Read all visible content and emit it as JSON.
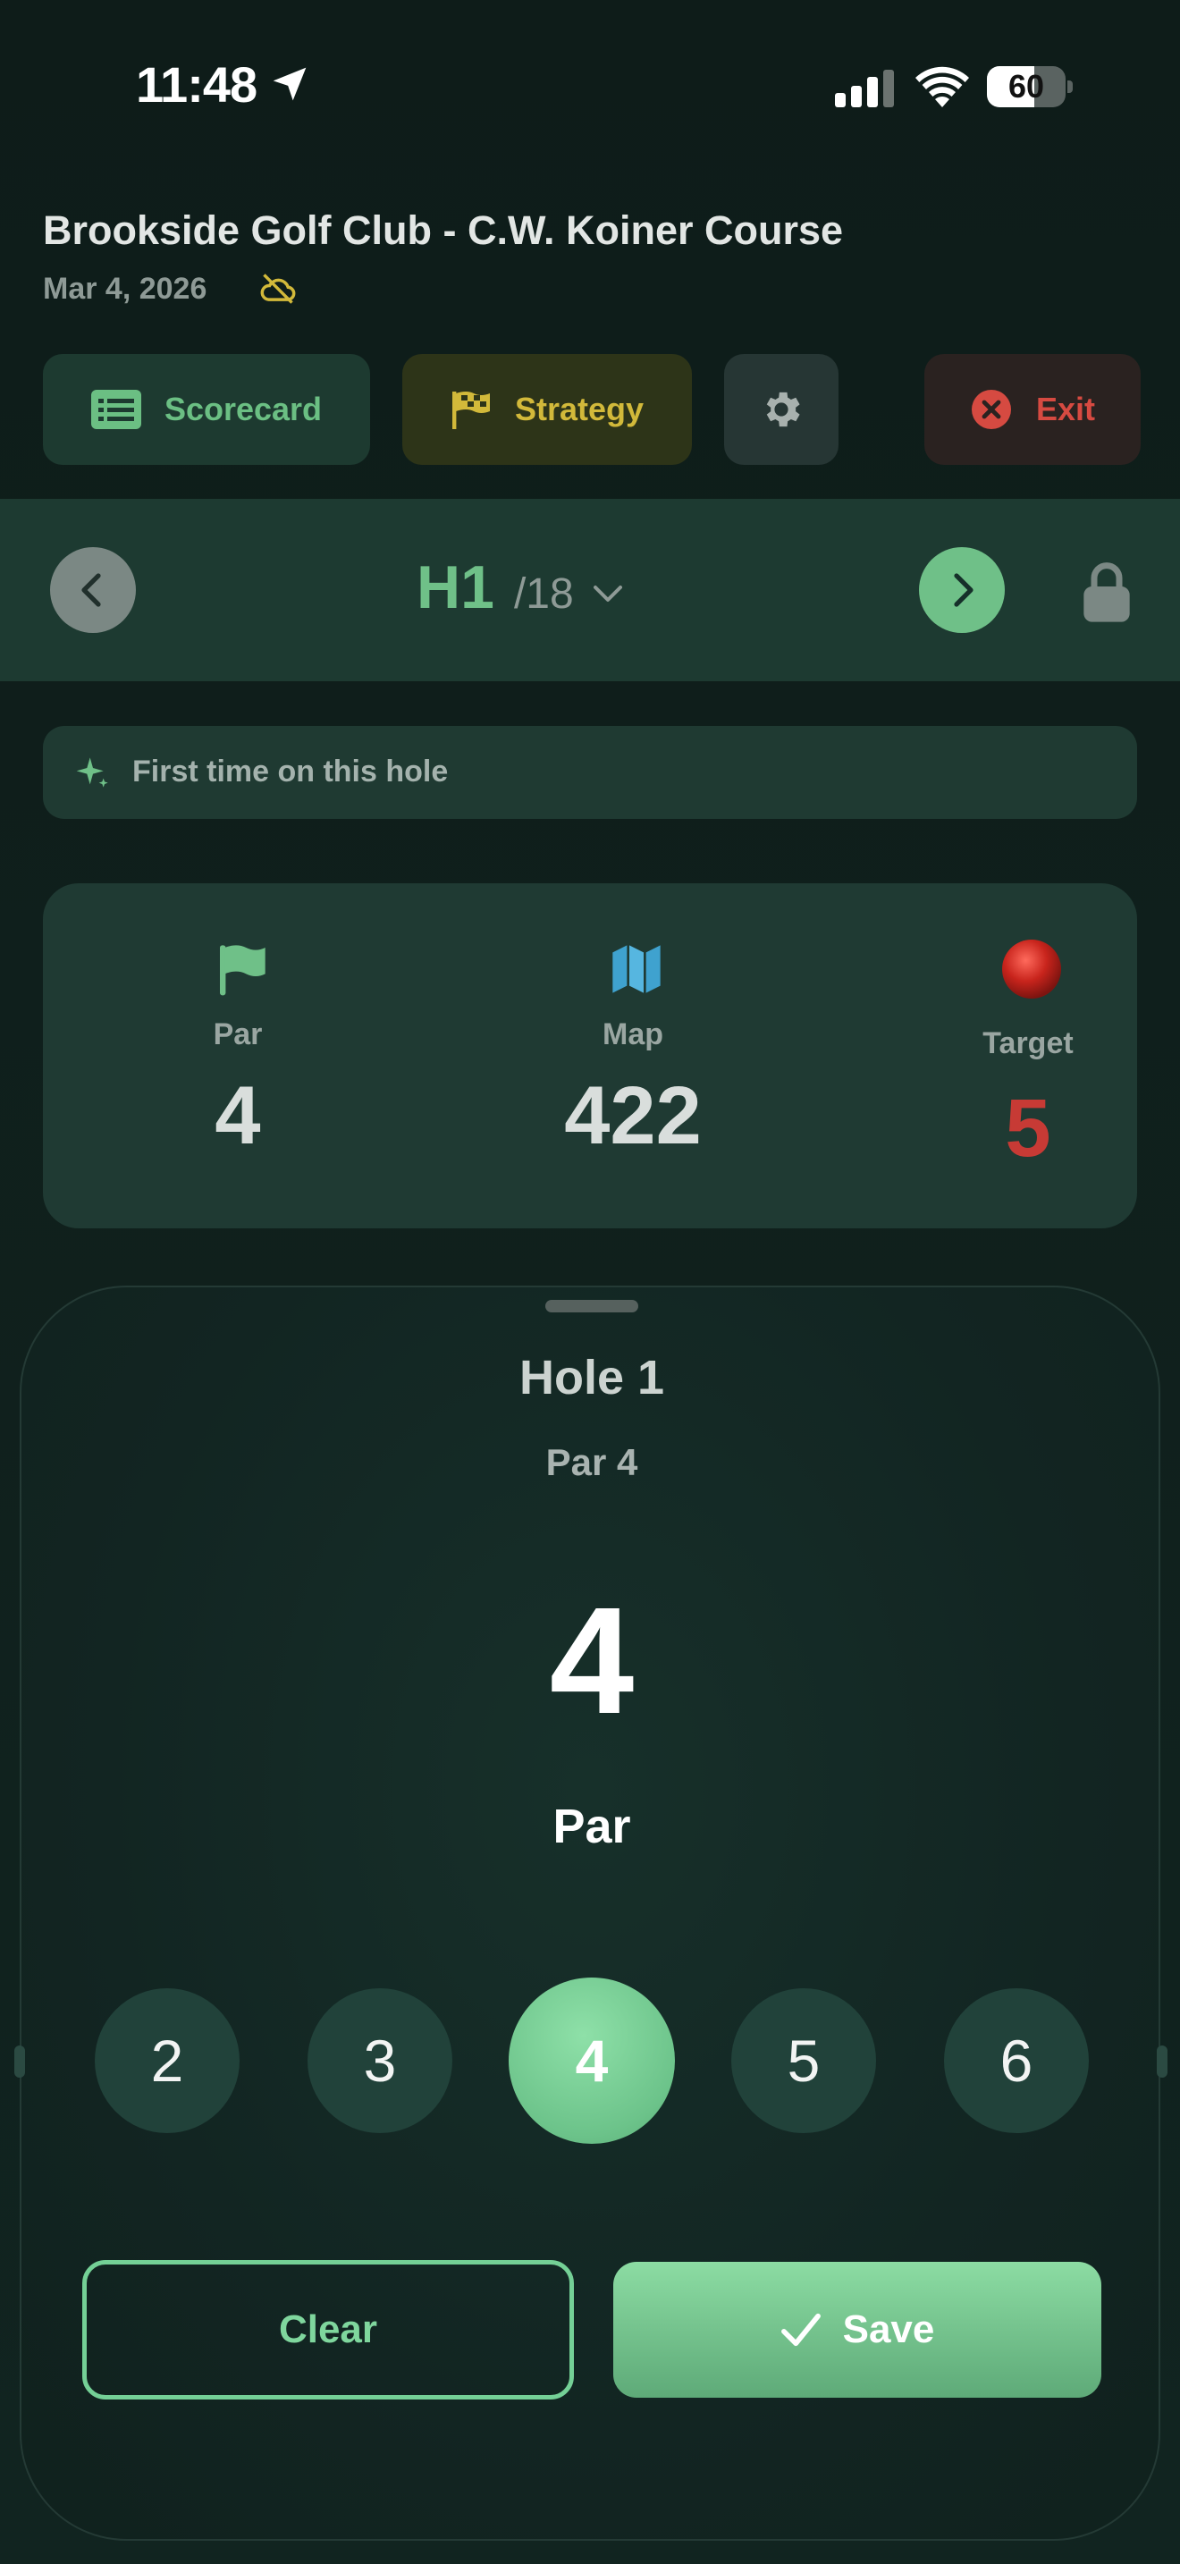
{
  "status_bar": {
    "time": "11:48",
    "battery": "60",
    "battery_level_pct": 60,
    "icons": [
      "location-arrow-icon",
      "cellular-signal-icon",
      "wifi-icon",
      "battery-icon"
    ]
  },
  "header": {
    "course_name": "Brookside Golf Club - C.W. Koiner Course",
    "date": "Mar 4, 2026",
    "weather_icon": "cloud-off-icon"
  },
  "toolbar": {
    "scorecard_label": "Scorecard",
    "strategy_label": "Strategy",
    "exit_label": "Exit",
    "colors": {
      "scorecard": "#6bbf83",
      "strategy": "#d2b93a",
      "exit": "#d64a41"
    }
  },
  "hole_nav": {
    "current": "H1",
    "total": "/18"
  },
  "banner": {
    "text": "First time on this hole"
  },
  "stats": {
    "par_label": "Par",
    "par_value": "4",
    "map_label": "Map",
    "map_value": "422",
    "target_label": "Target",
    "target_value": "5"
  },
  "score_sheet": {
    "title": "Hole 1",
    "par_text": "Par 4",
    "score": "4",
    "score_name": "Par",
    "options": [
      "2",
      "3",
      "4",
      "5",
      "6"
    ],
    "selected": "4",
    "clear_label": "Clear",
    "save_label": "Save"
  },
  "colors": {
    "accent_green": "#6fc088",
    "background": "#0f1f1c",
    "card": "#1f3a33",
    "target_red": "#c73a35"
  }
}
